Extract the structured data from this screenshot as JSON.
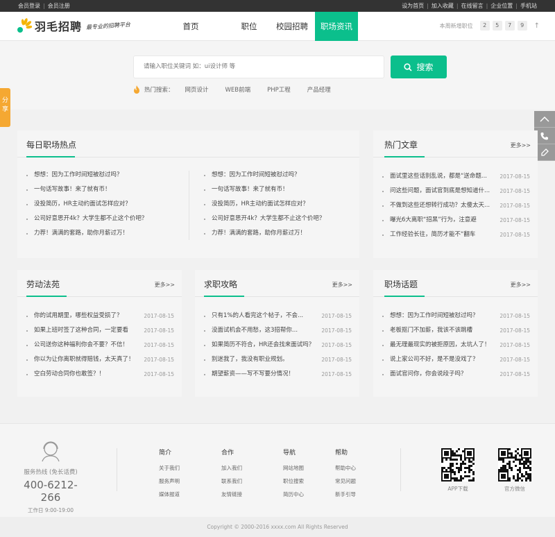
{
  "topbar": {
    "login": "会员登录",
    "register": "会员注册",
    "links": [
      "设为首页",
      "加入收藏",
      "在线留言",
      "企业位置",
      "手机站"
    ]
  },
  "brand": {
    "name": "羽毛招聘",
    "slogan": "最专业的招聘平台"
  },
  "nav": [
    "首页",
    "职位",
    "校园招聘",
    "职场资讯"
  ],
  "weekly": {
    "label": "本周新增职位",
    "digits": [
      "2",
      "5",
      "7",
      "9"
    ]
  },
  "search": {
    "placeholder": "请输入职位关键词 如：ui设计师 等",
    "button": "搜索",
    "hot_label": "热门搜索：",
    "hot_keywords": [
      "网页设计",
      "WEB前端",
      "PHP工程",
      "产品经理"
    ]
  },
  "share": "分享",
  "colors": {
    "accent": "#0bbf8c",
    "share": "#f5a832"
  },
  "panels": {
    "daily": {
      "title": "每日职场热点",
      "left": [
        "想想：因为工作时间短被怼过吗？",
        "一句话写故事！来了就有币！",
        "没投简历，HR主动约面试怎样应对？",
        "公司好意思开4k？大学生都不止这个价吧？",
        "力荐！满满的套路，助你月薪过万！"
      ],
      "right": [
        "想想：因为工作时间短被怼过吗？",
        "一句话写故事！来了就有币！",
        "没投简历，HR主动约面试怎样应对？",
        "公司好意思开4k？大学生都不止这个价吧？",
        "力荐！满满的套路，助你月薪过万！"
      ]
    },
    "hot": {
      "title": "热门文章",
      "more": "更多>>",
      "items": [
        {
          "t": "面试里这些话别乱说，都是“送命题...",
          "d": "2017-08-15"
        },
        {
          "t": "问这些问题，面试官到底是想知道什...",
          "d": "2017-08-15"
        },
        {
          "t": "不做到这些还想转行成功？太傻太天...",
          "d": "2017-08-15"
        },
        {
          "t": "曝光6大离职“招黑”行为，注意避",
          "d": "2017-08-15"
        },
        {
          "t": "工作经验长往，简历才能不“翻车",
          "d": "2017-08-15"
        }
      ]
    },
    "law": {
      "title": "劳动法苑",
      "more": "更多>>",
      "items": [
        {
          "t": "你的试用期里，哪些权益受损了？",
          "d": "2017-08-15"
        },
        {
          "t": "如果上班时签了这种合同，一定要看",
          "d": "2017-08-15"
        },
        {
          "t": "公司送你这种福利你会不要？不信！",
          "d": "2017-08-15"
        },
        {
          "t": "你以为让你离职就得赔钱，太天真了！",
          "d": "2017-08-15"
        },
        {
          "t": "空白劳动合同你也敢签？！",
          "d": "2017-08-15"
        }
      ]
    },
    "guide": {
      "title": "求职攻略",
      "more": "更多>>",
      "items": [
        {
          "t": "只有1%的人看完这个帖子，不会...",
          "d": "2017-08-15"
        },
        {
          "t": "没面试机会不用愁，这3招帮你...",
          "d": "2017-08-15"
        },
        {
          "t": "如果简历不符合，HR还会找来面试吗？",
          "d": "2017-08-15"
        },
        {
          "t": "别迷我了，我没有职业规划。",
          "d": "2017-08-15"
        },
        {
          "t": "期望薪资——写不写要分情况！",
          "d": "2017-08-15"
        }
      ]
    },
    "topic": {
      "title": "职场话题",
      "more": "更多>>",
      "items": [
        {
          "t": "想想：因为工作时间短被怼过吗？",
          "d": "2017-08-15"
        },
        {
          "t": "老板抠门不加薪，我该不该跳槽",
          "d": "2017-08-15"
        },
        {
          "t": "最无理最现实的被拒原因，太坑人了！",
          "d": "2017-08-15"
        },
        {
          "t": "说上家公司不好，是不是没戏了？",
          "d": "2017-08-15"
        },
        {
          "t": "面试官问你，你会说段子吗？",
          "d": "2017-08-15"
        }
      ]
    }
  },
  "footer": {
    "hotline": "服务热线 (免长话费)",
    "phone": "400-6212-266",
    "hours": "工作日 9:00-19:00",
    "cols": [
      {
        "h": "简介",
        "items": [
          "关于我们",
          "服务声明",
          "媒体报道"
        ]
      },
      {
        "h": "合作",
        "items": [
          "加入我们",
          "联系我们",
          "友情链接"
        ]
      },
      {
        "h": "导航",
        "items": [
          "网站地图",
          "职位搜索",
          "简历中心"
        ]
      },
      {
        "h": "帮助",
        "items": [
          "帮助中心",
          "常见问题",
          "新手引导"
        ]
      }
    ],
    "qr": [
      "APP下载",
      "官方微信"
    ]
  },
  "copyright": "Copyright © 2000-2016 xxxx.com All Rights Reserved"
}
